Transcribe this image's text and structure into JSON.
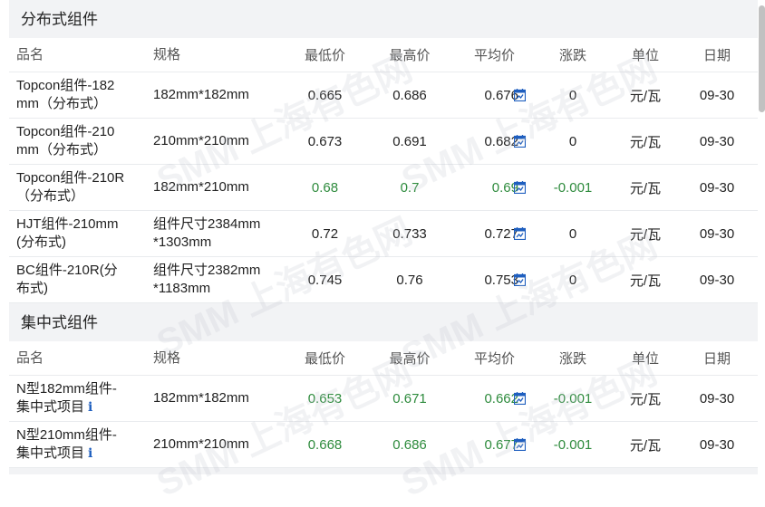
{
  "columns": [
    "品名",
    "规格",
    "最低价",
    "最高价",
    "平均价",
    "涨跌",
    "单位",
    "日期"
  ],
  "sections": [
    {
      "title": "分布式组件",
      "rows": [
        {
          "name": "Topcon组件-182mm（分布式）",
          "name1": "Topcon组件-182",
          "name2": "mm（分布式）",
          "spec1": "182mm*182mm",
          "spec2": "",
          "low": "0.665",
          "high": "0.686",
          "avg": "0.676",
          "change": "0",
          "unit": "元/瓦",
          "date": "09-30",
          "trend": "flat",
          "info": ""
        },
        {
          "name": "Topcon组件-210mm（分布式）",
          "name1": "Topcon组件-210",
          "name2": "mm（分布式）",
          "spec1": "210mm*210mm",
          "spec2": "",
          "low": "0.673",
          "high": "0.691",
          "avg": "0.682",
          "change": "0",
          "unit": "元/瓦",
          "date": "09-30",
          "trend": "flat",
          "info": ""
        },
        {
          "name": "Topcon组件-210R（分布式）",
          "name1": "Topcon组件-210R",
          "name2": "（分布式）",
          "spec1": "182mm*210mm",
          "spec2": "",
          "low": "0.68",
          "high": "0.7",
          "avg": "0.69",
          "change": "-0.001",
          "unit": "元/瓦",
          "date": "09-30",
          "trend": "down",
          "info": ""
        },
        {
          "name": "HJT组件-210mm(分布式)",
          "name1": "HJT组件-210mm",
          "name2": "(分布式)",
          "spec1": "组件尺寸2384mm",
          "spec2": "*1303mm",
          "low": "0.72",
          "high": "0.733",
          "avg": "0.727",
          "change": "0",
          "unit": "元/瓦",
          "date": "09-30",
          "trend": "flat",
          "info": ""
        },
        {
          "name": "BC组件-210R(分布式)",
          "name1": "BC组件-210R(分",
          "name2": "布式)",
          "spec1": "组件尺寸2382mm",
          "spec2": "*1183mm",
          "low": "0.745",
          "high": "0.76",
          "avg": "0.753",
          "change": "0",
          "unit": "元/瓦",
          "date": "09-30",
          "trend": "flat",
          "info": ""
        }
      ]
    },
    {
      "title": "集中式组件",
      "rows": [
        {
          "name": "N型182mm组件-集中式项目",
          "name1": "N型182mm组件-",
          "name2": "集中式项目",
          "spec1": "182mm*182mm",
          "spec2": "",
          "low": "0.653",
          "high": "0.671",
          "avg": "0.662",
          "change": "-0.001",
          "unit": "元/瓦",
          "date": "09-30",
          "trend": "down",
          "info": "i"
        },
        {
          "name": "N型210mm组件-集中式项目",
          "name1": "N型210mm组件-",
          "name2": "集中式项目",
          "spec1": "210mm*210mm",
          "spec2": "",
          "low": "0.668",
          "high": "0.686",
          "avg": "0.677",
          "change": "-0.001",
          "unit": "元/瓦",
          "date": "09-30",
          "trend": "down",
          "info": "i"
        }
      ]
    }
  ],
  "watermark": "SMM 上海有色网",
  "colors": {
    "down": "#2e8b3d",
    "flat": "#222222",
    "header_bg": "#f2f3f5",
    "icon": "#1f5fbf"
  },
  "icons": {
    "avg_icon": "calendar-chart-icon",
    "info_icon": "info-icon"
  }
}
